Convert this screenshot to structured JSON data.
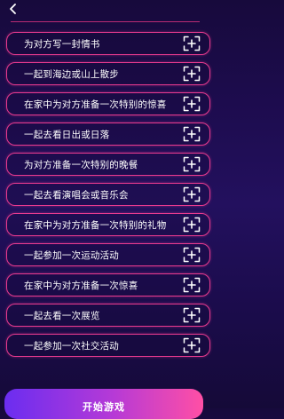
{
  "header": {
    "back_icon": "chevron-left-icon"
  },
  "colors": {
    "background_top": "#170a3c",
    "background_mid": "#23105e",
    "row_border": "#e83a8f",
    "button_gradient_start": "#6b2df0",
    "button_gradient_end": "#ff4fa5"
  },
  "tasks": [
    {
      "label": "为对方写一封情书",
      "icon": "add-box-icon"
    },
    {
      "label": "一起到海边或山上散步",
      "icon": "add-box-icon"
    },
    {
      "label": "在家中为对方准备一次特别的惊喜",
      "icon": "add-box-icon"
    },
    {
      "label": "一起去看日出或日落",
      "icon": "add-box-icon"
    },
    {
      "label": "为对方准备一次特别的晚餐",
      "icon": "add-box-icon"
    },
    {
      "label": "一起去看演唱会或音乐会",
      "icon": "add-box-icon"
    },
    {
      "label": "在家中为对方准备一次特别的礼物",
      "icon": "add-box-icon"
    },
    {
      "label": "一起参加一次运动活动",
      "icon": "add-box-icon"
    },
    {
      "label": "在家中为对方准备一次惊喜",
      "icon": "add-box-icon"
    },
    {
      "label": "一起去看一次展览",
      "icon": "add-box-icon"
    },
    {
      "label": "一起参加一次社交活动",
      "icon": "add-box-icon"
    }
  ],
  "footer": {
    "start_label": "开始游戏"
  }
}
